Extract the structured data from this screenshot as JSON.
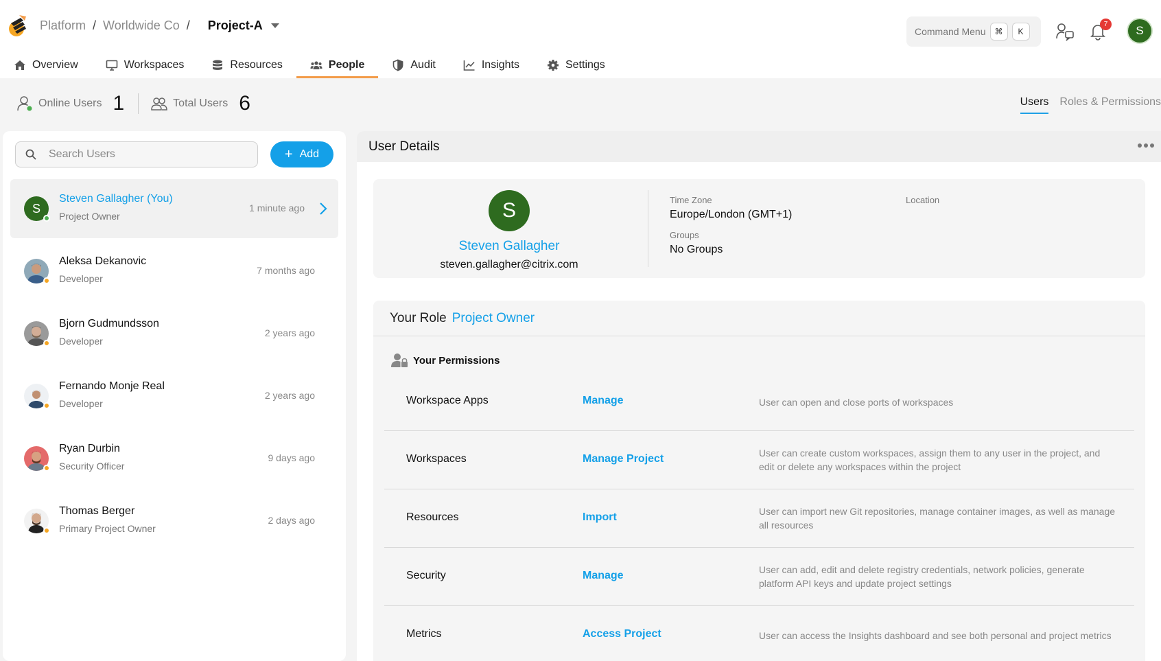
{
  "breadcrumb": {
    "items": [
      "Platform",
      "Worldwide Co"
    ],
    "separator": "/",
    "current": "Project-A"
  },
  "command_menu": {
    "label": "Command Menu",
    "keys": [
      "⌘",
      "K"
    ]
  },
  "header": {
    "notification_count": "7",
    "avatar_initial": "S"
  },
  "nav": {
    "tabs": [
      {
        "label": "Overview",
        "icon": "home-icon"
      },
      {
        "label": "Workspaces",
        "icon": "monitor-icon"
      },
      {
        "label": "Resources",
        "icon": "database-icon"
      },
      {
        "label": "People",
        "icon": "people-icon",
        "active": true
      },
      {
        "label": "Audit",
        "icon": "shield-icon"
      },
      {
        "label": "Insights",
        "icon": "chart-icon"
      },
      {
        "label": "Settings",
        "icon": "gear-icon"
      }
    ]
  },
  "stats": {
    "online_label": "Online Users",
    "online_count": "1",
    "total_label": "Total Users",
    "total_count": "6"
  },
  "view_tabs": {
    "users": "Users",
    "roles": "Roles & Permissions"
  },
  "search": {
    "placeholder": "Search Users"
  },
  "add_button": {
    "label": "Add"
  },
  "users": [
    {
      "name": "Steven Gallagher (You)",
      "role": "Project Owner",
      "last_seen": "1 minute ago",
      "status": "online",
      "initial": "S"
    },
    {
      "name": "Aleksa Dekanovic",
      "role": "Developer",
      "last_seen": "7 months ago",
      "status": "away"
    },
    {
      "name": "Bjorn Gudmundsson",
      "role": "Developer",
      "last_seen": "2 years ago",
      "status": "away"
    },
    {
      "name": "Fernando Monje Real",
      "role": "Developer",
      "last_seen": "2 years ago",
      "status": "away"
    },
    {
      "name": "Ryan Durbin",
      "role": "Security Officer",
      "last_seen": "9 days ago",
      "status": "away"
    },
    {
      "name": "Thomas Berger",
      "role": "Primary Project Owner",
      "last_seen": "2 days ago",
      "status": "away"
    }
  ],
  "details": {
    "title": "User Details",
    "initial": "S",
    "name": "Steven Gallagher",
    "email": "steven.gallagher@citrix.com",
    "timezone_label": "Time Zone",
    "timezone": "Europe/London (GMT+1)",
    "groups_label": "Groups",
    "groups": "No Groups",
    "location_label": "Location"
  },
  "role": {
    "label": "Your Role",
    "value": "Project Owner",
    "permissions_title": "Your Permissions",
    "permissions": [
      {
        "name": "Workspace Apps",
        "level": "Manage",
        "desc": "User can open and close ports of workspaces"
      },
      {
        "name": "Workspaces",
        "level": "Manage Project",
        "desc": "User can create custom workspaces, assign them to any user in the project, and edit or delete any workspaces within the project"
      },
      {
        "name": "Resources",
        "level": "Import",
        "desc": "User can import new Git repositories, manage container images, as well as manage all resources"
      },
      {
        "name": "Security",
        "level": "Manage",
        "desc": "User can add, edit and delete registry credentials, network policies, generate platform API keys and update project settings"
      },
      {
        "name": "Metrics",
        "level": "Access Project",
        "desc": "User can access the Insights dashboard and see both personal and project metrics"
      }
    ]
  },
  "colors": {
    "accent": "#14a0e8",
    "tab_underline": "#f39c4a",
    "avatar_green": "#2e6b1f",
    "online": "#4caf50",
    "away": "#f5a623",
    "badge": "#e53935"
  }
}
